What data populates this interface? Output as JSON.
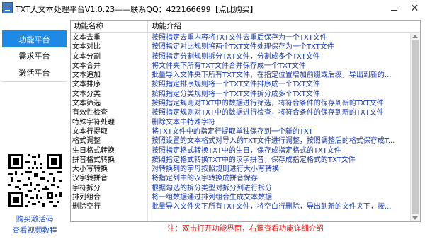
{
  "window": {
    "title": "TXT大文本处理平台V1.0.23——联系QQ：422166699【点此购买】"
  },
  "sidebar": {
    "items": [
      {
        "label": "功能平台",
        "active": true
      },
      {
        "label": "需求平台",
        "active": false
      },
      {
        "label": "激活平台",
        "active": false
      }
    ],
    "buy_link": "购买激活码",
    "video_link": "查看视频教程"
  },
  "table": {
    "headers": [
      "功能名称",
      "功能介绍"
    ],
    "rows": [
      {
        "name": "文本去重",
        "desc": "按照指定去重内容将TXT文件去重后保存为一个TXT文件"
      },
      {
        "name": "文本对比",
        "desc": "按照指定对比规则将两个TXT文件处理保存为一个TXT文件"
      },
      {
        "name": "文本分割",
        "desc": "按照指定分割规则拆分TXT文件，分割成多个TXT文件"
      },
      {
        "name": "文本合并",
        "desc": "将文件夹下所有TXT文件合并保存成一个TXT文件"
      },
      {
        "name": "文本追加",
        "desc": "批量导入文件夹下所有TXT文件，在指定位置增加前缀或后缀，导出到新的..."
      },
      {
        "name": "文本排序",
        "desc": "按照指定排序规则将一个TXT文件排序成一个TXT文件"
      },
      {
        "name": "文本分类",
        "desc": "按照指定分类规则将一个TXT文件拆分成多个TXT文件"
      },
      {
        "name": "文本筛选",
        "desc": "按照指定规则对TXT中的数据进行筛选，将符合条件的保存到新的TXT文件"
      },
      {
        "name": "有效性检查",
        "desc": "按照指定规则对TXT中的数据进行检查，将符合条件的保存到新的TXT文件"
      },
      {
        "name": "特殊字符处理",
        "desc": "删除文本中特殊字符"
      },
      {
        "name": "文本行提取",
        "desc": "将TXT文件中的指定行提取单独保存到一个新的TXT"
      },
      {
        "name": "格式调整",
        "desc": "按照设置的文本格式对导入的TXT文件进行调整，按照调整后的格式保存成T..."
      },
      {
        "name": "生日格式转换",
        "desc": "按照指定格式转换TXT中的生日，保存成指定格式的TXT文件"
      },
      {
        "name": "拼音格式转换",
        "desc": "按照指定格式转换TXT中的汉字拼音，保存成指定格式的TXT文件"
      },
      {
        "name": "大小写转换",
        "desc": "对转换列的字母按照规则进行大小写转换"
      },
      {
        "name": "汉字转拼音",
        "desc": "将指定列中的汉字转换成拼音保存"
      },
      {
        "name": "字符拆分",
        "desc": "根据勾选的拆分类型对拆分列进行拆分"
      },
      {
        "name": "排列组合",
        "desc": "将一组数据通过排列组合生成文本数据"
      },
      {
        "name": "删除空行",
        "desc": "批量导入文件夹下所有TXT文件，将空白行删除，导出到新的文件夹下，按..."
      }
    ]
  },
  "status_hint": "注：双击打开功能界面，右键查看功能详细介绍",
  "icons": {
    "app": "app-icon",
    "minimize": "minimize-icon",
    "close": "close-icon",
    "qr": "qr-code-icon"
  },
  "colors": {
    "accent": "#1e8ae6",
    "desc_text": "#1a3aaa",
    "hint_text": "#e02020",
    "link": "#1e50c8"
  }
}
